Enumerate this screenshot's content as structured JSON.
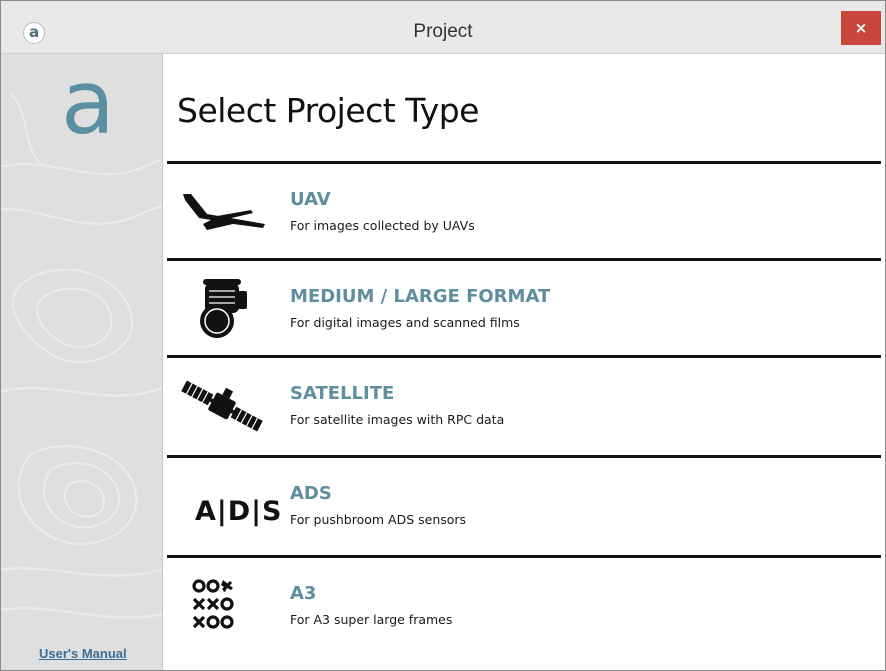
{
  "window": {
    "title": "Project",
    "close_label": "×",
    "app_icon_glyph": "a"
  },
  "sidebar": {
    "logo_glyph": "a",
    "users_manual_label": "User's Manual"
  },
  "page": {
    "title": "Select Project Type"
  },
  "options": [
    {
      "label": "UAV",
      "description": "For images collected by UAVs",
      "icon": "uav-drone-icon"
    },
    {
      "label": "MEDIUM / LARGE FORMAT",
      "description": "For digital images and scanned films",
      "icon": "camera-icon"
    },
    {
      "label": "SATELLITE",
      "description": "For satellite images with RPC data",
      "icon": "satellite-icon"
    },
    {
      "label": "ADS",
      "description": "For pushbroom ADS sensors",
      "icon": "ads-sensor-icon",
      "icon_text": "A|D|S"
    },
    {
      "label": "A3",
      "description": "For A3 super large frames",
      "icon": "a3-frames-icon"
    }
  ],
  "colors": {
    "accent": "#5f8ea0",
    "close_button": "#c8463c",
    "link": "#3d6f95"
  }
}
